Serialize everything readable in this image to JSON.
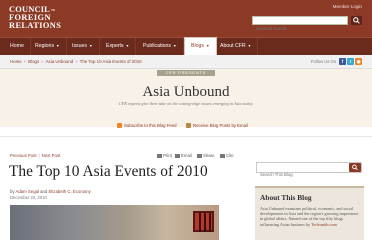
{
  "header": {
    "logo": {
      "line1": "COUNCIL",
      "line1_small": "on",
      "line2": "FOREIGN",
      "line3": "RELATIONS"
    },
    "member_login": "Member Login",
    "search": {
      "placeholder": "Keyword search",
      "button_icon": "search-icon"
    }
  },
  "nav": {
    "items": [
      {
        "label": "Home"
      },
      {
        "label": "Regions",
        "caret": "▼"
      },
      {
        "label": "Issues",
        "caret": "▼"
      },
      {
        "label": "Experts",
        "caret": "▼"
      },
      {
        "label": "Publications",
        "caret": "▼"
      },
      {
        "label": "Blogs",
        "caret": "▼",
        "active": true
      },
      {
        "label": "About CFR",
        "caret": "▼"
      }
    ]
  },
  "breadcrumb": {
    "items": [
      "Home",
      "Blogs",
      "Asia Unbound",
      "The Top 10 Asia Events of 2010"
    ],
    "separator": "»",
    "follow_label": "Follow Us On",
    "social_icons": [
      "facebook-icon",
      "twitter-icon",
      "rss-icon"
    ]
  },
  "blog": {
    "tag": "CFR PRESENTS",
    "title": "Asia Unbound",
    "tagline": "CFR experts give their take on the cutting-edge issues emerging in Asia today.",
    "subscribe_feed": "Subscribe to this Blog Feed",
    "receive_email": "Receive Blog Posts by Email"
  },
  "post": {
    "prev": "Previous Post",
    "separator": "|",
    "next": "Next Post",
    "tools": [
      "Print",
      "Email",
      "Share",
      "Cite"
    ],
    "title": "The Top 10 Asia Events of 2010",
    "byline_prefix": "by",
    "author1": "Adam Segal",
    "byline_and": "and",
    "author2": "Elizabeth C. Economy",
    "date": "December 23, 2010"
  },
  "sidebar": {
    "search_placeholder": "Search This Blog",
    "about_title": "About This Blog",
    "about_text": "Asia Unbound examines political, economic, and social developments in Asia and the region's growing importance in global affairs. Named one of the top fifty blogs influencing Asian business by",
    "about_link": "Techsmith.com"
  },
  "colors": {
    "brand": "#8c3a26",
    "nav": "#6a2a1c",
    "banner": "#f7f1e8",
    "sidebar_box": "#ece6dc"
  }
}
